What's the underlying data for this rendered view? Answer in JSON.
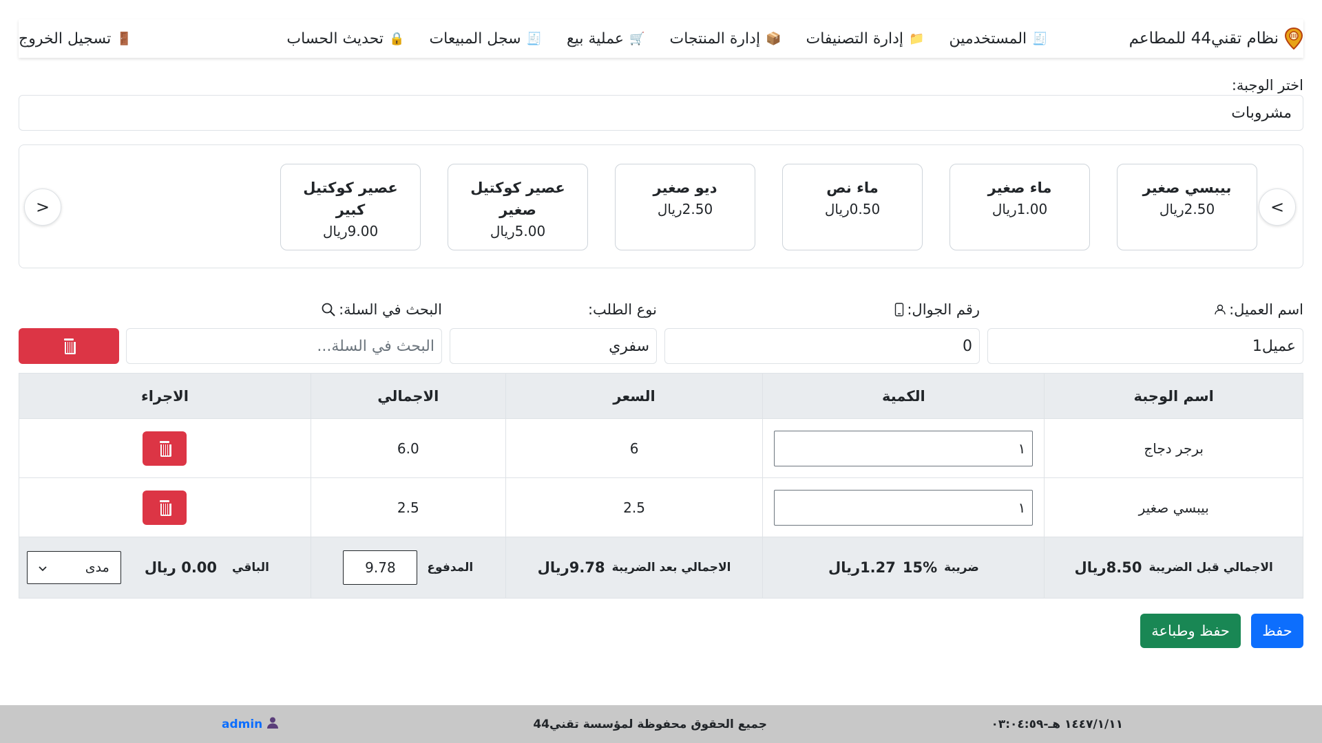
{
  "nav": {
    "brand": "نظام تقني44 للمطاعم",
    "brand_icon": "location-pin-icon",
    "items": [
      {
        "label": "المستخدمين",
        "icon": "receipt-icon"
      },
      {
        "label": "إدارة التصنيفات",
        "icon": "folder-icon"
      },
      {
        "label": "إدارة المنتجات",
        "icon": "box-icon"
      },
      {
        "label": "عملية بيع",
        "icon": "cart-icon"
      },
      {
        "label": "سجل المبيعات",
        "icon": "receipt-icon"
      },
      {
        "label": "تحديث الحساب",
        "icon": "lock-icon"
      }
    ],
    "logout": "تسجيل الخروج"
  },
  "meal": {
    "label": "اختر الوجبة:",
    "selected": "مشروبات"
  },
  "products": [
    {
      "name": "بيبسي صغير",
      "price": "2.50ريال"
    },
    {
      "name": "ماء صغير",
      "price": "1.00ريال"
    },
    {
      "name": "ماء نص",
      "price": "0.50ريال"
    },
    {
      "name": "ديو صغير",
      "price": "2.50ريال"
    },
    {
      "name": "عصير كوكتيل صغير",
      "price": "5.00ريال"
    },
    {
      "name": "عصير كوكتيل كبير",
      "price": "9.00ريال"
    }
  ],
  "carousel": {
    "next": ">",
    "prev": "<"
  },
  "order": {
    "customer_label": "اسم العميل:",
    "customer_value": "عميل1",
    "phone_label": "رقم الجوال:",
    "phone_value": "0",
    "type_label": "نوع الطلب:",
    "type_value": "سفري",
    "search_label": "البحث في السلة:",
    "search_placeholder": "البحث في السلة..."
  },
  "cart": {
    "headers": [
      "اسم الوجبة",
      "الكمية",
      "السعر",
      "الاجمالي",
      "الاجراء"
    ],
    "rows": [
      {
        "name": "برجر دجاج",
        "qty": "١",
        "price": "6",
        "total": "6.0"
      },
      {
        "name": "بيبسي صغير",
        "qty": "١",
        "price": "2.5",
        "total": "2.5"
      }
    ],
    "footer": {
      "before_tax_label": "الاجمالي قبل الضريبة",
      "before_tax_value": "8.50ريال",
      "tax_label": "ضريبة",
      "tax_rate": "15%",
      "tax_value": "1.27ريال",
      "after_tax_label": "الاجمالي بعد الضريبة",
      "after_tax_value": "9.78ريال",
      "paid_label": "المدفوع",
      "paid_value": "9.78",
      "remaining_label": "الباقي",
      "remaining_value": "0.00 ريال",
      "payment_method": "مدى"
    }
  },
  "actions": {
    "save": "حفظ",
    "save_print": "حفظ وطباعة"
  },
  "footer": {
    "datetime": "١٤٤٧/١/١١ هـ-٠٣:٠٤:٥٩",
    "copyright": "جميع الحقوق محفوظة لمؤسسة تقني44",
    "user": "admin"
  },
  "colors": {
    "danger": "#dc3545",
    "primary": "#0d6efd",
    "success": "#198754"
  }
}
